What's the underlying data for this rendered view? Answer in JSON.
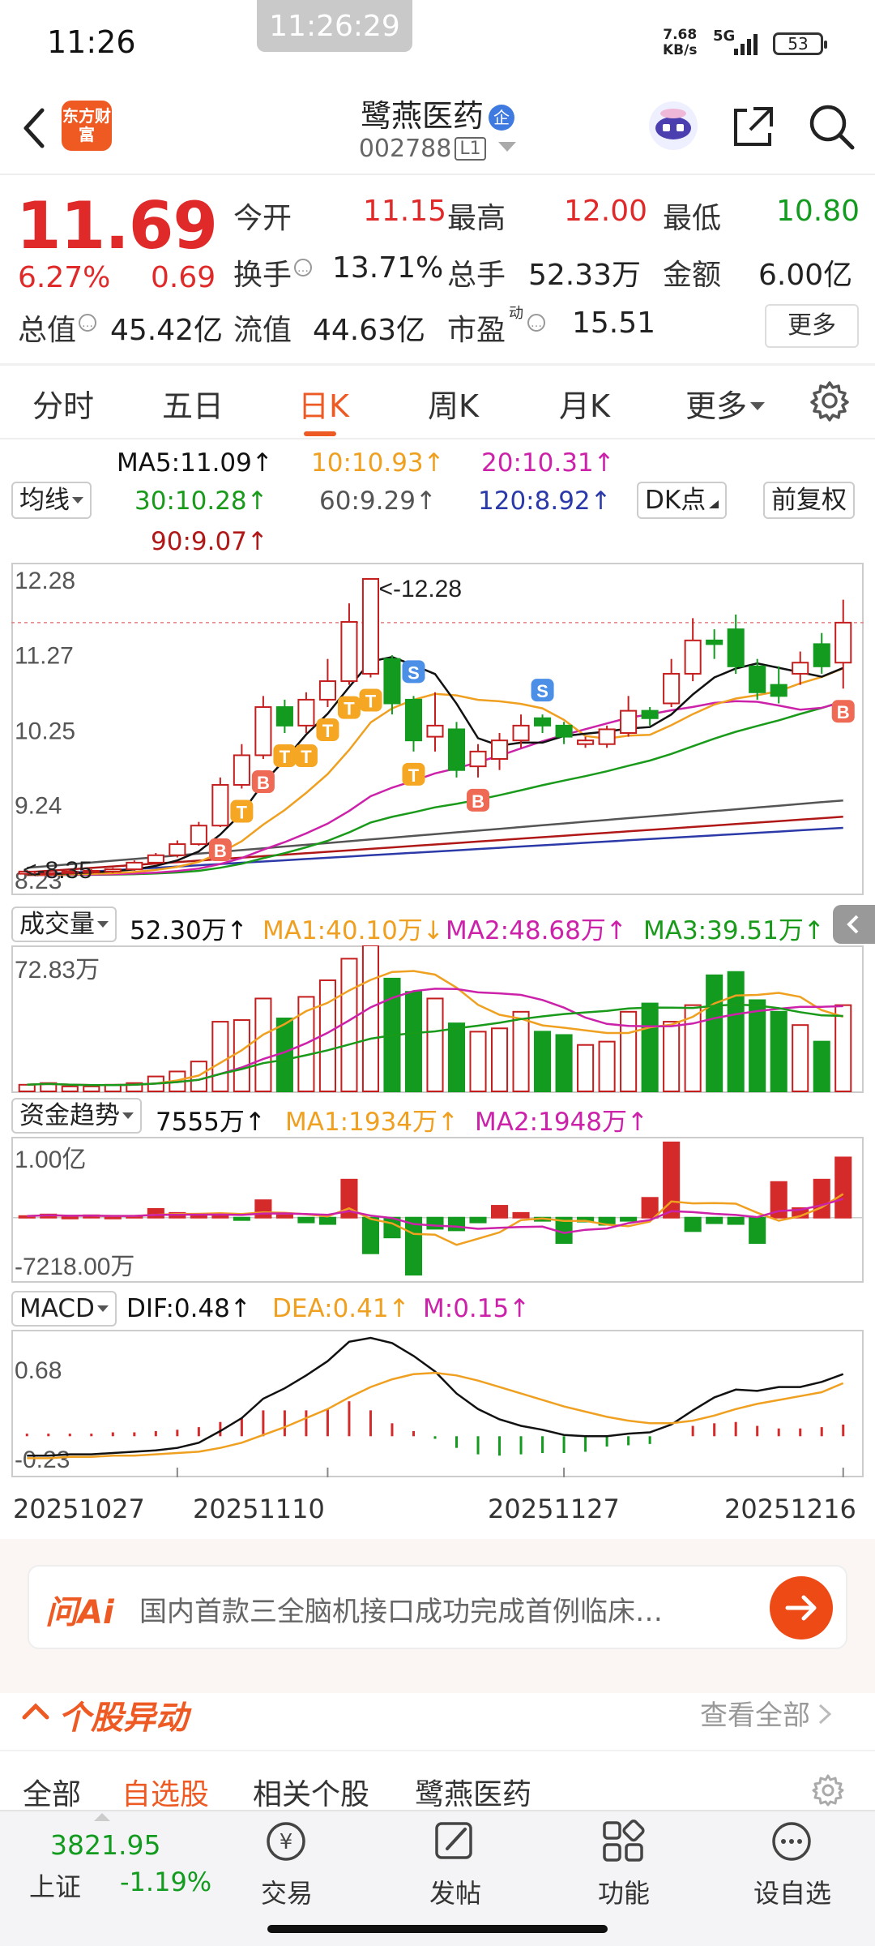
{
  "status": {
    "time": "11:26",
    "center_time": "11:26:29",
    "net_speed_value": "7.68",
    "net_speed_unit": "KB/s",
    "network": "5G",
    "battery": "53"
  },
  "header": {
    "app_logo_text": "东方财富",
    "stock_name": "鹭燕医药",
    "stock_badge": "企",
    "stock_code": "002788",
    "market_level": "L1"
  },
  "quote": {
    "price": "11.69",
    "change_pct": "6.27%",
    "change_amt": "0.69",
    "open_label": "今开",
    "open": "11.15",
    "high_label": "最高",
    "high": "12.00",
    "low_label": "最低",
    "low": "10.80",
    "turnover_label": "换手",
    "turnover": "13.71%",
    "volume_label": "总手",
    "volume": "52.33万",
    "amount_label": "金额",
    "amount": "6.00亿",
    "mktcap_label": "总值",
    "mktcap": "45.42亿",
    "float_label": "流值",
    "float_cap": "44.63亿",
    "pe_label": "市盈",
    "pe_sup": "动",
    "pe": "15.51",
    "more_label": "更多"
  },
  "tabs": [
    "分时",
    "五日",
    "日K",
    "周K",
    "月K",
    "更多"
  ],
  "active_tab": "日K",
  "ma_legend": {
    "selector": "均线",
    "ma5": "MA5:11.09↑",
    "ma10": "10:10.93↑",
    "ma20": "20:10.31↑",
    "ma30": "30:10.28↑",
    "ma60": "60:9.29↑",
    "ma120": "120:8.92↑",
    "ma90": "90:9.07↑",
    "dk_label": "DK点",
    "adjust_label": "前复权"
  },
  "colors": {
    "accent": "#ee5a23",
    "up": "#e02a2a",
    "down": "#129b1e",
    "ma5": "#111111",
    "ma10": "#f0a020",
    "ma20": "#cc22aa",
    "ma30": "#1a9a1a",
    "ma60": "#555555",
    "ma90": "#b01818",
    "ma120": "#2b3aa8"
  },
  "chart_data": [
    {
      "type": "candlestick",
      "title": "日K",
      "y_ticks": [
        "12.28",
        "11.27",
        "10.25",
        "9.24",
        "8.23"
      ],
      "ylim": [
        8.23,
        12.28
      ],
      "annotations": {
        "high": "<-12.28",
        "low": "<-8.35"
      },
      "x_ticks": [
        "20251027",
        "20251110",
        "20251127",
        "20251216"
      ],
      "candles": [
        [
          8.3,
          8.33,
          8.28,
          8.35
        ],
        [
          8.3,
          8.31,
          8.28,
          8.34
        ],
        [
          8.31,
          8.33,
          8.29,
          8.35
        ],
        [
          8.32,
          8.34,
          8.3,
          8.36
        ],
        [
          8.33,
          8.36,
          8.31,
          8.38
        ],
        [
          8.36,
          8.45,
          8.34,
          8.48
        ],
        [
          8.45,
          8.55,
          8.43,
          8.58
        ],
        [
          8.55,
          8.7,
          8.52,
          8.75
        ],
        [
          8.7,
          8.95,
          8.68,
          9.0
        ],
        [
          8.95,
          9.5,
          8.93,
          9.6
        ],
        [
          9.5,
          9.9,
          9.45,
          10.05
        ],
        [
          9.9,
          10.55,
          9.85,
          10.7
        ],
        [
          10.55,
          10.3,
          10.2,
          10.65
        ],
        [
          10.3,
          10.65,
          10.2,
          10.75
        ],
        [
          10.65,
          10.9,
          10.55,
          11.2
        ],
        [
          10.9,
          11.7,
          10.85,
          11.95
        ],
        [
          11.0,
          12.28,
          10.95,
          12.28
        ],
        [
          11.2,
          10.6,
          10.45,
          11.25
        ],
        [
          10.65,
          10.1,
          9.95,
          10.7
        ],
        [
          10.15,
          10.3,
          9.95,
          10.75
        ],
        [
          10.25,
          9.7,
          9.6,
          10.35
        ],
        [
          9.75,
          9.95,
          9.6,
          10.05
        ],
        [
          9.85,
          10.1,
          9.7,
          10.2
        ],
        [
          10.1,
          10.3,
          10.0,
          10.45
        ],
        [
          10.4,
          10.3,
          10.2,
          10.45
        ],
        [
          10.3,
          10.15,
          10.05,
          10.35
        ],
        [
          10.05,
          10.1,
          10.0,
          10.15
        ],
        [
          10.05,
          10.25,
          10.0,
          10.3
        ],
        [
          10.2,
          10.5,
          10.15,
          10.7
        ],
        [
          10.5,
          10.4,
          10.3,
          10.55
        ],
        [
          10.6,
          11.0,
          10.55,
          11.2
        ],
        [
          11.0,
          11.45,
          10.9,
          11.75
        ],
        [
          11.45,
          11.4,
          11.2,
          11.6
        ],
        [
          11.6,
          11.1,
          11.0,
          11.8
        ],
        [
          11.1,
          10.75,
          10.65,
          11.2
        ],
        [
          10.85,
          10.7,
          10.6,
          11.1
        ],
        [
          11.0,
          11.15,
          10.85,
          11.3
        ],
        [
          11.4,
          11.1,
          11.0,
          11.55
        ],
        [
          11.15,
          11.69,
          10.8,
          12.0
        ]
      ],
      "signals": [
        {
          "type": "B",
          "index": 9
        },
        {
          "type": "B",
          "index": 11
        },
        {
          "type": "T",
          "index": 10
        },
        {
          "type": "T",
          "index": 12
        },
        {
          "type": "T",
          "index": 13
        },
        {
          "type": "T",
          "index": 14
        },
        {
          "type": "T",
          "index": 15
        },
        {
          "type": "T",
          "index": 16
        },
        {
          "type": "T",
          "index": 18
        },
        {
          "type": "S",
          "index": 18
        },
        {
          "type": "S",
          "index": 24
        },
        {
          "type": "B",
          "index": 21
        },
        {
          "type": "B",
          "index": 38
        }
      ]
    },
    {
      "type": "bar",
      "title": "成交量",
      "selector": "成交量",
      "legend": {
        "vol": "52.30万↑",
        "ma1": "MA1:40.10万↓",
        "ma2": "MA2:48.68万↑",
        "ma3": "MA3:39.51万↑"
      },
      "y_ticks": [
        "72.83万"
      ],
      "values": [
        4,
        5,
        3,
        3,
        4,
        5,
        9,
        12,
        18,
        42,
        43,
        56,
        44,
        57,
        67,
        80,
        88,
        68,
        60,
        56,
        41,
        36,
        38,
        48,
        36,
        34,
        28,
        30,
        48,
        53,
        42,
        52,
        70,
        72,
        55,
        48,
        40,
        30,
        52
      ]
    },
    {
      "type": "bar",
      "title": "资金趋势",
      "selector": "资金趋势",
      "legend": {
        "val": "7555万↑",
        "ma1": "MA1:1934万↑",
        "ma2": "MA2:1948万↑"
      },
      "y_ticks": [
        "1.00亿",
        "-7218.00万"
      ],
      "values": [
        0.02,
        0.04,
        0.01,
        0.03,
        0.01,
        0.02,
        0.11,
        0.06,
        0.04,
        0.05,
        -0.03,
        0.22,
        0.03,
        -0.06,
        -0.08,
        0.48,
        -0.45,
        -0.25,
        -0.72,
        -0.14,
        -0.16,
        -0.06,
        0.15,
        0.06,
        -0.04,
        -0.32,
        -0.05,
        -0.09,
        -0.04,
        0.25,
        0.95,
        -0.17,
        -0.07,
        -0.08,
        -0.32,
        0.45,
        0.12,
        0.48,
        0.76
      ]
    },
    {
      "type": "bar",
      "title": "MACD",
      "selector": "MACD",
      "legend": {
        "dif": "DIF:0.48↑",
        "dea": "DEA:0.41↑",
        "m": "M:0.15↑"
      },
      "y_ticks": [
        "0.68",
        "-0.23"
      ],
      "values": [
        0.02,
        0.02,
        0.02,
        0.02,
        0.03,
        0.03,
        0.04,
        0.05,
        0.07,
        0.11,
        0.14,
        0.2,
        0.2,
        0.2,
        0.21,
        0.27,
        0.2,
        0.1,
        0.04,
        -0.02,
        -0.09,
        -0.14,
        -0.15,
        -0.14,
        -0.13,
        -0.13,
        -0.12,
        -0.08,
        -0.07,
        -0.06,
        0.0,
        0.08,
        0.1,
        0.11,
        0.08,
        0.06,
        0.06,
        0.07,
        0.09
      ]
    }
  ],
  "ai": {
    "logo": "问Ai",
    "text": "国内首款三全脑机接口成功完成首例临床…"
  },
  "movement": {
    "title": "个股异动",
    "see_all": "查看全部",
    "subtabs": [
      "全部",
      "自选股",
      "相关个股",
      "鹭燕医药"
    ],
    "active_subtab": "自选股"
  },
  "bottom_nav": {
    "index_value": "3821.95",
    "index_name": "上证",
    "index_change": "-1.19%",
    "items": [
      "交易",
      "发帖",
      "功能",
      "设自选"
    ]
  }
}
